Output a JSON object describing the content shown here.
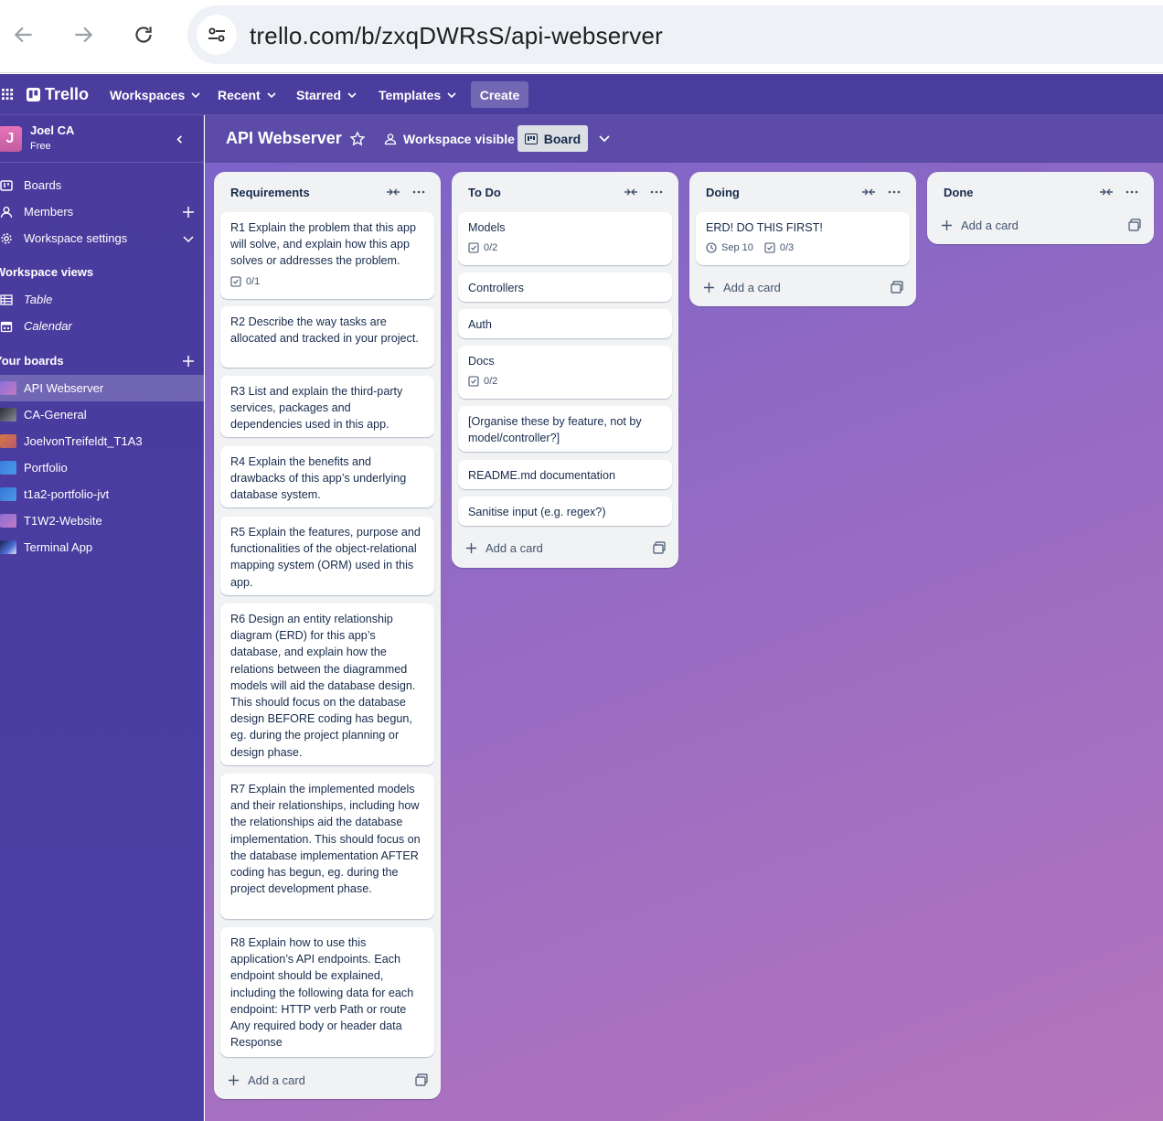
{
  "browser": {
    "url": "trello.com/b/zxqDWRsS/api-webserver"
  },
  "header": {
    "logo": "Trello",
    "menus": [
      "Workspaces",
      "Recent",
      "Starred",
      "Templates"
    ],
    "create_label": "Create"
  },
  "sidebar": {
    "workspace_initial": "J",
    "workspace_name": "Joel CA",
    "workspace_plan": "Free",
    "nav": [
      {
        "label": "Boards",
        "icon": "boards-icon"
      },
      {
        "label": "Members",
        "icon": "members-icon"
      },
      {
        "label": "Workspace settings",
        "icon": "settings-icon"
      }
    ],
    "views_heading": "Workspace views",
    "views": [
      {
        "label": "Table",
        "icon": "table-icon"
      },
      {
        "label": "Calendar",
        "icon": "calendar-icon"
      }
    ],
    "boards_heading": "Your boards",
    "boards": [
      {
        "label": "API Webserver",
        "color": "#a072d0",
        "active": true
      },
      {
        "label": "CA-General",
        "color": "#5b5b6b"
      },
      {
        "label": "JoelvonTreifeldt_T1A3",
        "color": "#d06a4a"
      },
      {
        "label": "Portfolio",
        "color": "#3f7fd6"
      },
      {
        "label": "t1a2-portfolio-jvt",
        "color": "#3b82d9"
      },
      {
        "label": "T1W2-Website",
        "color": "#9b6acb"
      },
      {
        "label": "Terminal App",
        "color": "#2a3f7a"
      }
    ]
  },
  "board": {
    "title": "API Webserver",
    "visibility": "Workspace visible",
    "view_label": "Board"
  },
  "lists": [
    {
      "title": "Requirements",
      "cards": [
        {
          "text": "R1 Explain the problem that this app will solve, and explain how this app solves or addresses the problem.",
          "checklist": "0/1"
        },
        {
          "text": "R2 Describe the way tasks are allocated and tracked in your project."
        },
        {
          "text": "R3 List and explain the third-party services, packages and dependencies used in this app."
        },
        {
          "text": "R4 Explain the benefits and drawbacks of this app’s underlying database system."
        },
        {
          "text": "R5 Explain the features, purpose and functionalities of the object-relational mapping system (ORM) used in this app."
        },
        {
          "text": "R6 Design an entity relationship diagram (ERD) for this app’s database, and explain how the relations between the diagrammed models will aid the database design. This should focus on the database design BEFORE coding has begun, eg. during the project planning or design phase."
        },
        {
          "text": "R7 Explain the implemented models and their relationships, including how the relationships aid the database implementation. This should focus on the database implementation AFTER coding has begun, eg. during the project development phase."
        },
        {
          "text": "R8 Explain how to use this application’s API endpoints. Each endpoint should be explained, including the following data for each endpoint: HTTP verb Path or route Any required body or header data Response"
        }
      ],
      "add_label": "Add a card"
    },
    {
      "title": "To Do",
      "cards": [
        {
          "text": "Models",
          "checklist": "0/2"
        },
        {
          "text": "Controllers"
        },
        {
          "text": "Auth"
        },
        {
          "text": "Docs",
          "checklist": "0/2"
        },
        {
          "text": "[Organise these by feature, not by model/controller?]"
        },
        {
          "text": "README.md documentation"
        },
        {
          "text": "Sanitise input (e.g. regex?)"
        }
      ],
      "add_label": "Add a card"
    },
    {
      "title": "Doing",
      "cards": [
        {
          "text": "ERD! DO THIS FIRST!",
          "due": "Sep 10",
          "checklist": "0/3"
        }
      ],
      "add_label": "Add a card"
    },
    {
      "title": "Done",
      "cards": [],
      "add_label": "Add a card"
    }
  ]
}
